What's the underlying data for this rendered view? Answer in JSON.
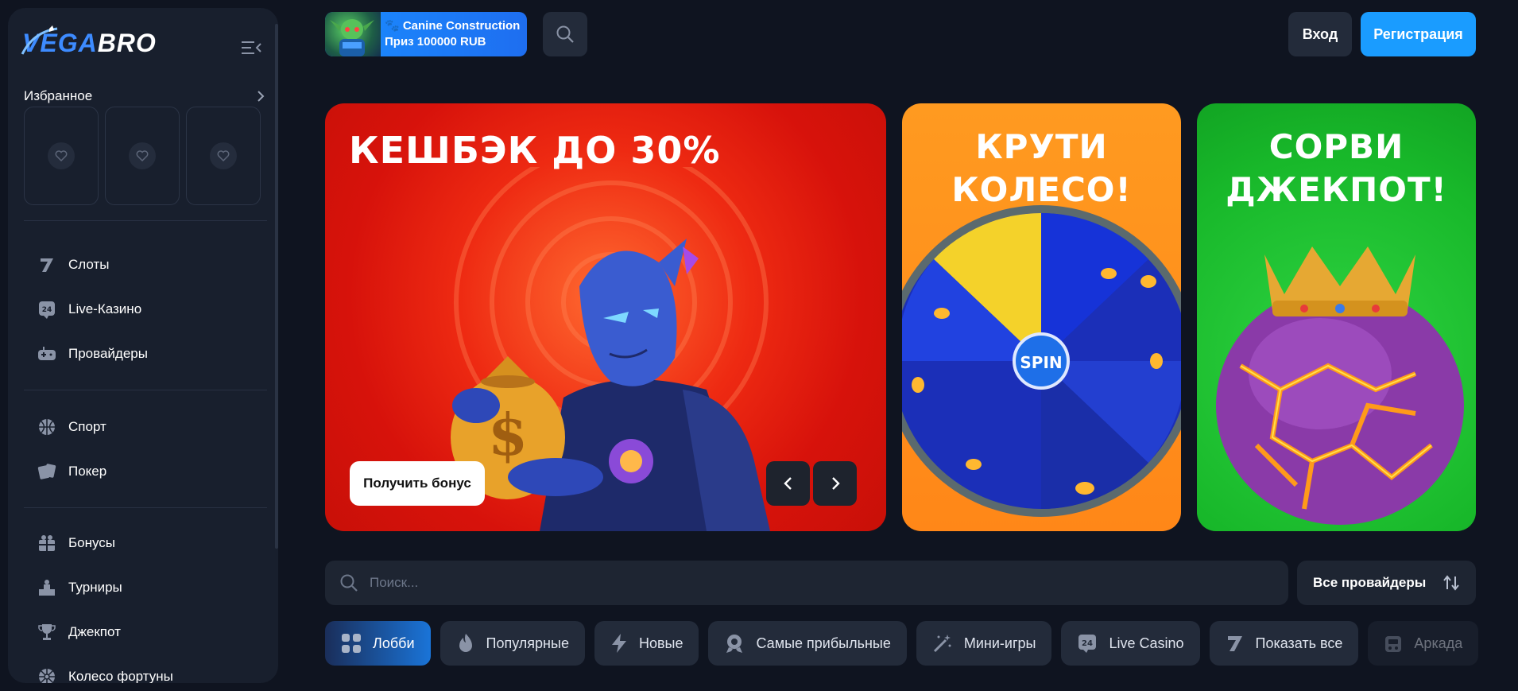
{
  "brand": {
    "logo_part1": "VEGA",
    "logo_part2": "BRO"
  },
  "favorites": {
    "title": "Избранное"
  },
  "nav_groups": [
    [
      {
        "label": "Слоты",
        "icon": "seven-icon"
      },
      {
        "label": "Live-Казино",
        "icon": "live-24-icon"
      },
      {
        "label": "Провайдеры",
        "icon": "gamepad-icon"
      }
    ],
    [
      {
        "label": "Спорт",
        "icon": "basketball-icon"
      },
      {
        "label": "Покер",
        "icon": "cards-icon"
      }
    ],
    [
      {
        "label": "Бонусы",
        "icon": "gift-icon"
      },
      {
        "label": "Турниры",
        "icon": "podium-icon"
      },
      {
        "label": "Джекпот",
        "icon": "trophy-icon"
      },
      {
        "label": "Колесо фортуны",
        "icon": "wheel-icon"
      }
    ]
  ],
  "promo": {
    "line1": "🐾 Canine Construction",
    "line2": "Приз 100000 RUB"
  },
  "header": {
    "login": "Вход",
    "register": "Регистрация"
  },
  "banners": [
    {
      "title": "КЕШБЭК ДО 30%",
      "button": "Получить бонус"
    },
    {
      "title_line1": "КРУТИ",
      "title_line2": "КОЛЕСО!",
      "spin": "SPIN"
    },
    {
      "title_line1": "СОРВИ",
      "title_line2": "ДЖЕКПОТ!"
    }
  ],
  "search": {
    "placeholder": "Поиск..."
  },
  "providers": {
    "label": "Все провайдеры"
  },
  "tabs": [
    {
      "label": "Лобби",
      "icon": "grid-icon",
      "active": true
    },
    {
      "label": "Популярные",
      "icon": "flame-icon"
    },
    {
      "label": "Новые",
      "icon": "lightning-icon"
    },
    {
      "label": "Самые прибыльные",
      "icon": "medal-icon"
    },
    {
      "label": "Мини-игры",
      "icon": "magic-wand-icon"
    },
    {
      "label": "Live Casino",
      "icon": "live-24-icon"
    },
    {
      "label": "Показать все",
      "icon": "seven-icon"
    },
    {
      "label": "Аркада",
      "icon": "arcade-icon"
    }
  ],
  "colors": {
    "bg": "#0f1420",
    "sidebar": "#181f2d",
    "accent": "#1a9cff",
    "card": "#232b3a"
  }
}
